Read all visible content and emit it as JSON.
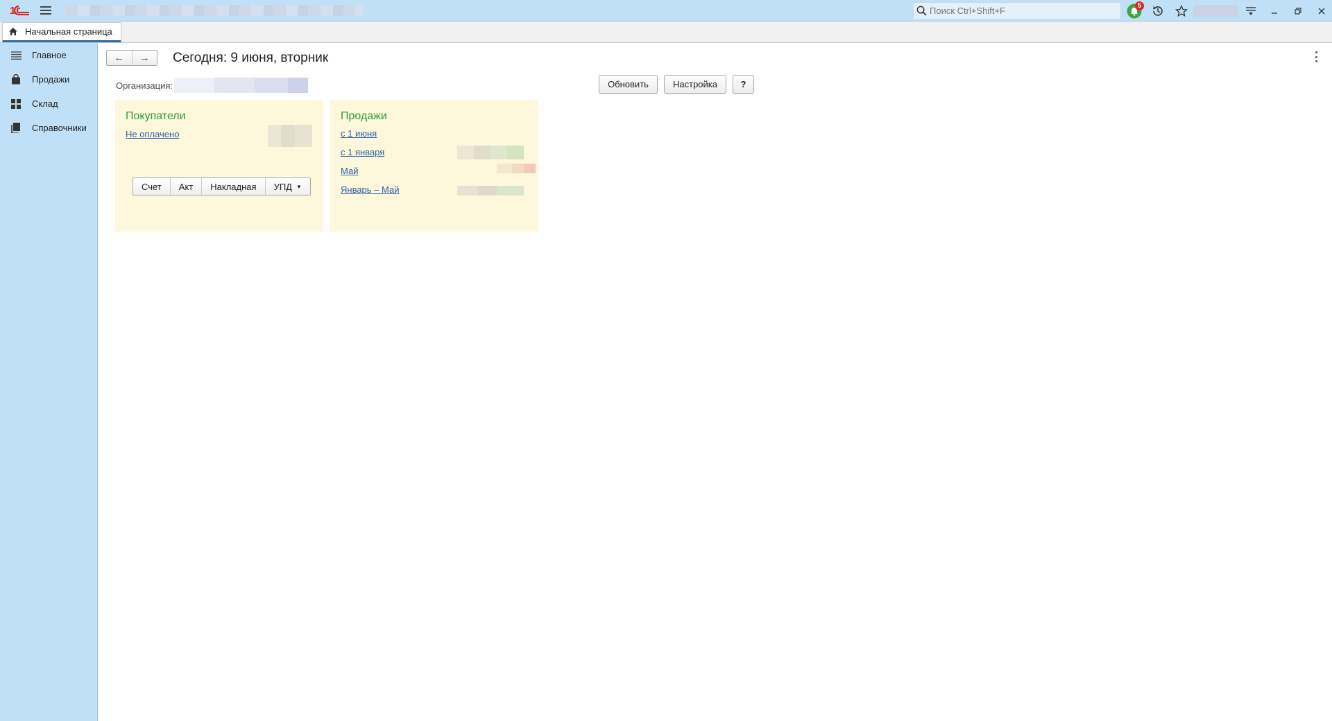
{
  "search": {
    "placeholder": "Поиск Ctrl+Shift+F"
  },
  "notifications": {
    "count": "5"
  },
  "tabs": {
    "home": "Начальная страница"
  },
  "sidebar": {
    "items": [
      {
        "label": "Главное",
        "icon": "hamburger-list-icon"
      },
      {
        "label": "Продажи",
        "icon": "shopping-bag-icon"
      },
      {
        "label": "Склад",
        "icon": "warehouse-grid-icon"
      },
      {
        "label": "Справочники",
        "icon": "books-icon"
      }
    ]
  },
  "main": {
    "title": "Сегодня: 9 июня, вторник",
    "org_label": "Организация:",
    "buttons": {
      "refresh": "Обновить",
      "settings": "Настройка",
      "help": "?"
    }
  },
  "buyers": {
    "title": "Покупатели",
    "unpaid": "Не оплачено",
    "docs": [
      "Счет",
      "Акт",
      "Накладная",
      "УПД"
    ]
  },
  "sales": {
    "title": "Продажи",
    "links": [
      "с 1 июня",
      "с 1 января",
      "Май",
      "Январь – Май"
    ]
  },
  "colors": {
    "accent": "#bfe0f6",
    "panel_bg": "#fdf8dc",
    "panel_title": "#2c9a3a",
    "link": "#2b5ea8",
    "logo": "#d62a1f"
  }
}
